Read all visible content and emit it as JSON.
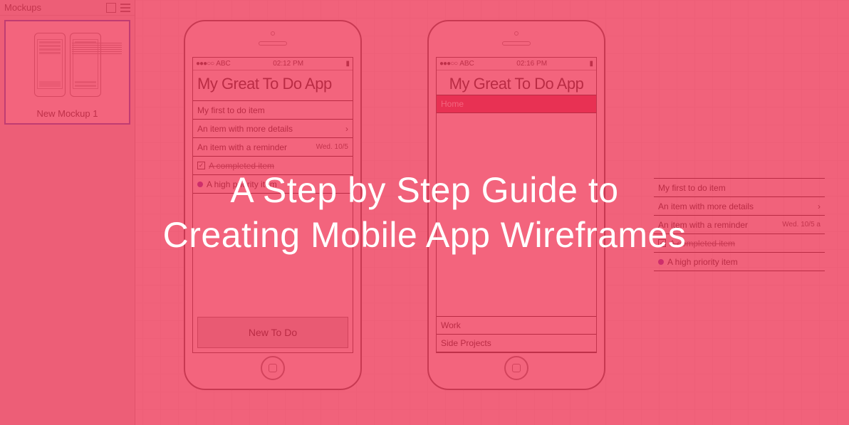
{
  "sidebar": {
    "title": "Mockups",
    "thumb_label": "New Mockup 1"
  },
  "phone1": {
    "carrier": "ABC",
    "time": "02:12 PM",
    "title": "My Great To Do App",
    "items": {
      "i0": "My first to do item",
      "i1": "An item with more details",
      "i2": "An item with a reminder",
      "i2_sub": "Wed. 10/5",
      "i3": "A completed item",
      "i4": "A high priority item"
    },
    "button": "New To Do"
  },
  "phone2": {
    "carrier": "ABC",
    "time": "02:16 PM",
    "title": "My Great To Do App",
    "sections": {
      "home": "Home",
      "work": "Work",
      "side": "Side Projects"
    }
  },
  "float": {
    "i0": "My first to do item",
    "i1": "An item with more details",
    "i2": "An item with a reminder",
    "i2_sub": "Wed. 10/5 a",
    "i3": "A completed item",
    "i4": "A high priority item"
  },
  "overlay": {
    "line1": "A Step by Step Guide to",
    "line2": "Creating Mobile App Wireframes"
  }
}
